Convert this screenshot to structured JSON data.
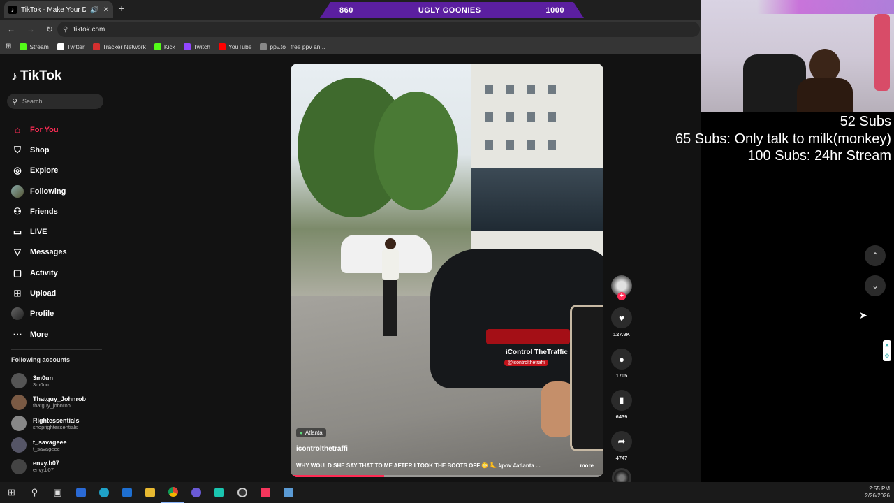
{
  "browser": {
    "tab_title": "TikTok - Make Your Day",
    "url": "tiktok.com",
    "bookmarks": [
      {
        "label": "Stream",
        "color": "#53fc18"
      },
      {
        "label": "Twitter",
        "color": "#ffffff"
      },
      {
        "label": "Tracker Network",
        "color": "#d32f2f"
      },
      {
        "label": "Kick",
        "color": "#53fc18"
      },
      {
        "label": "Twitch",
        "color": "#9146ff"
      },
      {
        "label": "YouTube",
        "color": "#ff0000"
      },
      {
        "label": "ppv.to | free ppv an...",
        "color": "#888888"
      }
    ]
  },
  "overlay_bar": {
    "left_value": "860",
    "title": "UGLY GOONIES",
    "right_value": "1000"
  },
  "tiktok": {
    "logo": "TikTok",
    "search_placeholder": "Search",
    "menu": [
      {
        "label": "For You",
        "icon": "home-icon",
        "glyph": "⌂",
        "active": true
      },
      {
        "label": "Shop",
        "icon": "shop-icon",
        "glyph": "🛍"
      },
      {
        "label": "Explore",
        "icon": "compass-icon",
        "glyph": "◎"
      },
      {
        "label": "Following",
        "icon": "avatar",
        "glyph": ""
      },
      {
        "label": "Friends",
        "icon": "friends-icon",
        "glyph": "⚇"
      },
      {
        "label": "LIVE",
        "icon": "live-icon",
        "glyph": "▭"
      },
      {
        "label": "Messages",
        "icon": "send-icon",
        "glyph": "▽"
      },
      {
        "label": "Activity",
        "icon": "activity-icon",
        "glyph": "▢"
      },
      {
        "label": "Upload",
        "icon": "upload-icon",
        "glyph": "⊞"
      },
      {
        "label": "Profile",
        "icon": "avatar",
        "glyph": ""
      },
      {
        "label": "More",
        "icon": "more-icon",
        "glyph": "⋯"
      }
    ],
    "following_title": "Following accounts",
    "following": [
      {
        "name": "3m0un",
        "handle": "3m0un"
      },
      {
        "name": "Thatguy_Johnrob",
        "handle": "thatguy_johnrob"
      },
      {
        "name": "Rightessentials",
        "handle": "shoprightessentials"
      },
      {
        "name": "t_savageee",
        "handle": "t_savageee"
      },
      {
        "name": "envy.b07",
        "handle": "envy.b07"
      }
    ],
    "video": {
      "location": "Atlanta",
      "author": "icontrolthetraffi",
      "caption": "WHY WOULD SHE SAY THAT TO ME AFTER I TOOK THE BOOTS OFF 😳 🦶 #pov #atlanta ...",
      "more_label": "more",
      "watermark": "iControl TheTraffic",
      "watermark_handle": "@icontrolthetraffi",
      "progress": 0.3
    },
    "actions": {
      "likes": "127.9K",
      "comments": "1705",
      "saves": "6439",
      "shares": "4747"
    }
  },
  "stream_goals": {
    "line1": "52 Subs",
    "line2": "65 Subs: Only talk to milk(monkey)",
    "line3": "100 Subs: 24hr Stream"
  },
  "taskbar": {
    "time": "2:55 PM",
    "date": "2/26/2026"
  }
}
